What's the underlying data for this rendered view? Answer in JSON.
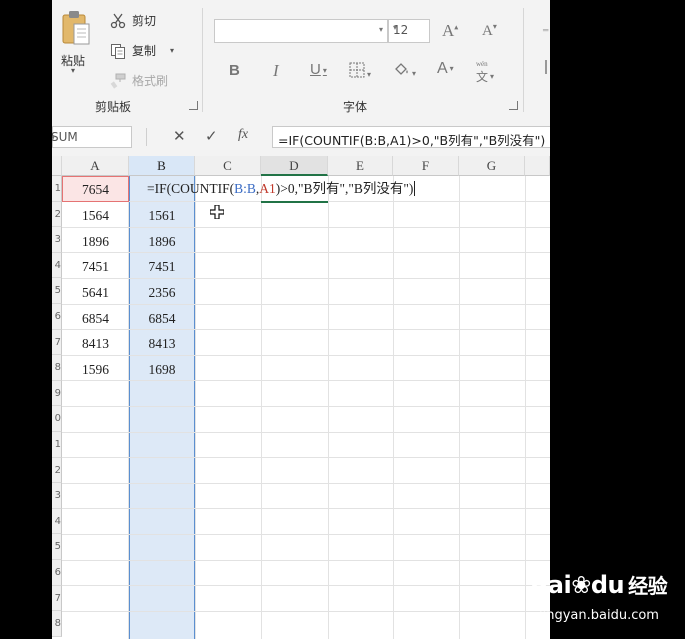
{
  "ribbon": {
    "paste": {
      "label": "粘贴",
      "arrow": "▾"
    },
    "clipboard": {
      "cut_label": "剪切",
      "copy_label": "复制",
      "format_painter_label": "格式刷",
      "group_title": "剪贴板"
    },
    "font": {
      "font_name": "",
      "font_size": "12",
      "increase_size": "A",
      "decrease_size": "A",
      "bold": "B",
      "italic": "I",
      "underline": "U",
      "font_color": "A",
      "phonetic_top": "wén",
      "phonetic_char": "文",
      "group_title": "字体"
    }
  },
  "formula_bar": {
    "name_box": "SUM",
    "cancel_icon": "✕",
    "enter_icon": "✓",
    "fx": "fx",
    "formula": "=IF(COUNTIF(B:B,A1)>0,\"B列有\",\"B列没有\")"
  },
  "columns": [
    "A",
    "B",
    "C",
    "D",
    "E",
    "F",
    "G"
  ],
  "row_headers": [
    "1",
    "2",
    "3",
    "4",
    "5",
    "6",
    "7",
    "8",
    "9",
    "0",
    "1",
    "2",
    "3",
    "4",
    "5",
    "6",
    "7",
    "8"
  ],
  "rows": [
    {
      "a": "7654",
      "b": ""
    },
    {
      "a": "1564",
      "b": "1561"
    },
    {
      "a": "1896",
      "b": "1896"
    },
    {
      "a": "7451",
      "b": "7451"
    },
    {
      "a": "5641",
      "b": "2356"
    },
    {
      "a": "6854",
      "b": "6854"
    },
    {
      "a": "8413",
      "b": "8413"
    },
    {
      "a": "1596",
      "b": "1698"
    }
  ],
  "in_cell_formula": {
    "pre": "=IF(COUNTIF(",
    "ref_b": "B:B",
    "comma": ",",
    "ref_a": "A1",
    "post": ")>0,\"B列有\",\"B列没有\")"
  },
  "colors": {
    "excel_green": "#217346",
    "selection_blue": "#5b8fd0",
    "reference_red": "#e57373"
  },
  "watermark": {
    "logo": "Bai",
    "logo_mid": "du",
    "logo_suffix": "经验",
    "url": "jingyan.baidu.com"
  }
}
